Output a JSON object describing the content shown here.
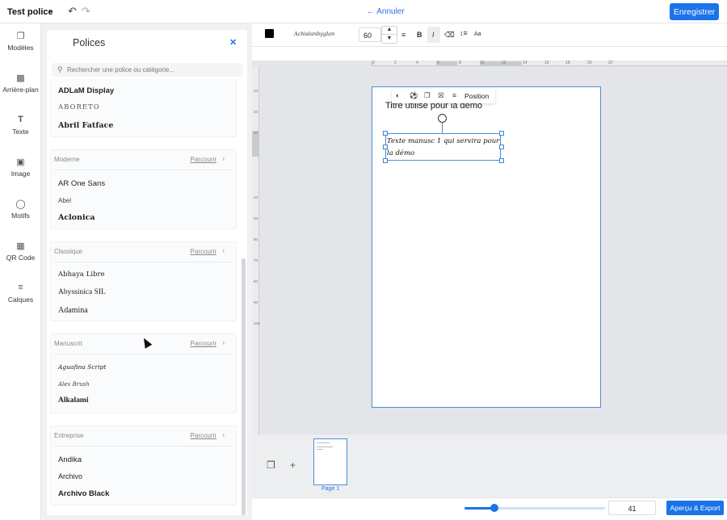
{
  "topbar": {
    "doc_title": "Test police",
    "doc_chevron_icon": "chevron-down-icon",
    "undo_icon": "undo-icon",
    "redo_icon": "redo-icon",
    "cancel_label": "Annuler",
    "save_label": "Enregistrer"
  },
  "rail": {
    "items": [
      {
        "label": "Modèles",
        "icon": "templates-icon"
      },
      {
        "label": "Arrière-plan",
        "icon": "background-icon"
      },
      {
        "label": "Texte",
        "icon": "text-icon"
      },
      {
        "label": "Image",
        "icon": "image-icon"
      },
      {
        "label": "Motifs",
        "icon": "shapes-icon"
      },
      {
        "label": "QR Code",
        "icon": "qrcode-icon"
      },
      {
        "label": "Calques",
        "icon": "layers-icon"
      }
    ]
  },
  "font_panel": {
    "title": "Polices",
    "search_placeholder": "Rechercher une police ou catégorie...",
    "top_list": [
      "ADLaM Display",
      "ABORETO",
      "Abril Fatface"
    ],
    "browse_label": "Parcourir",
    "categories": [
      {
        "name": "Moderne",
        "fonts": [
          "AR One Sans",
          "Abel",
          "Aclonica"
        ]
      },
      {
        "name": "Classique",
        "fonts": [
          "Abhaya Libre",
          "Abyssinica SIL",
          "Adamina"
        ]
      },
      {
        "name": "Manuscrit",
        "fonts": [
          "Aguafina Script",
          "Alex Brush",
          "Alkalami"
        ]
      },
      {
        "name": "Entreprise",
        "fonts": [
          "Andika",
          "Archivo",
          "Archivo Black"
        ]
      }
    ]
  },
  "text_toolbar": {
    "color": "#000000",
    "font_name": "Achislanbyglan",
    "font_size": "60",
    "bold_label": "B",
    "italic_label": "I",
    "case_label": "Aa"
  },
  "canvas": {
    "ruler_labels": [
      "0",
      "2",
      "4",
      "6",
      "8",
      "10",
      "12",
      "14",
      "16",
      "18",
      "20",
      "22"
    ],
    "vruler_labels": [
      "10",
      "20",
      "30",
      "40",
      "50",
      "60",
      "70",
      "80",
      "90",
      "100"
    ],
    "page_title": "Titre utilise pour la demo",
    "selected_text": "Texte manusc 1 qui servira pour la démo",
    "float_toolbar_position": "Position"
  },
  "pages_strip": {
    "page_label": "Page 1"
  },
  "bottom": {
    "zoom_value": "41",
    "zoom_fraction": 0.21,
    "export_label": "Aperçu & Export"
  },
  "colors": {
    "accent": "#1a73e8",
    "selection": "#4a8fd8"
  }
}
